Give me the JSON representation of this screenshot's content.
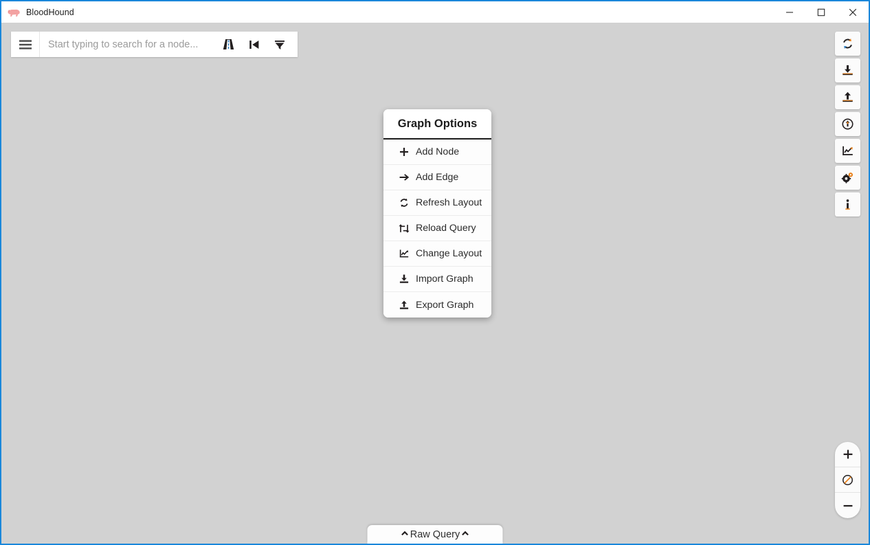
{
  "window": {
    "title": "BloodHound",
    "app_icon": "bloodhound-logo-icon",
    "controls": {
      "minimize": "minimize-icon",
      "maximize": "maximize-icon",
      "close": "close-icon"
    },
    "border_color": "#1a87da"
  },
  "search": {
    "placeholder": "Start typing to search for a node...",
    "value": "",
    "menu_icon": "hamburger-menu-icon",
    "actions": [
      {
        "icon": "pathfinding-road-icon",
        "name": "pathfinding-button"
      },
      {
        "icon": "tier-zero-skip-back-icon",
        "name": "tier-zero-button"
      },
      {
        "icon": "filter-funnel-icon",
        "name": "filter-button"
      }
    ]
  },
  "toolbar": {
    "buttons": [
      {
        "icon": "refresh-icon",
        "name": "refresh-graph-button"
      },
      {
        "icon": "download-import-icon",
        "name": "import-graph-button"
      },
      {
        "icon": "upload-export-icon",
        "name": "export-graph-button"
      },
      {
        "icon": "add-node-circle-icon",
        "name": "add-node-button"
      },
      {
        "icon": "chart-layout-icon",
        "name": "change-layout-button"
      },
      {
        "icon": "gears-settings-icon",
        "name": "settings-button"
      },
      {
        "icon": "info-icon",
        "name": "info-button"
      }
    ]
  },
  "zoom_controls": {
    "buttons": [
      {
        "icon": "plus-icon",
        "name": "zoom-in-button",
        "label": "+"
      },
      {
        "icon": "no-entry-reset-icon",
        "name": "zoom-reset-button",
        "label": ""
      },
      {
        "icon": "minus-icon",
        "name": "zoom-out-button",
        "label": "−"
      }
    ]
  },
  "raw_query": {
    "label": "Raw Query",
    "left_icon": "chevron-up-icon",
    "right_icon": "chevron-up-icon"
  },
  "context_menu": {
    "title": "Graph Options",
    "items": [
      {
        "label": "Add Node",
        "icon": "plus-icon",
        "name": "menu-item-add-node"
      },
      {
        "label": "Add Edge",
        "icon": "arrow-right-icon",
        "name": "menu-item-add-edge"
      },
      {
        "label": "Refresh Layout",
        "icon": "refresh-icon",
        "name": "menu-item-refresh-layout"
      },
      {
        "label": "Reload Query",
        "icon": "retweet-reload-icon",
        "name": "menu-item-reload-query"
      },
      {
        "label": "Change Layout",
        "icon": "chart-layout-icon",
        "name": "menu-item-change-layout"
      },
      {
        "label": "Import Graph",
        "icon": "download-import-icon",
        "name": "menu-item-import-graph"
      },
      {
        "label": "Export Graph",
        "icon": "upload-export-icon",
        "name": "menu-item-export-graph"
      }
    ]
  },
  "colors": {
    "canvas": "#d2d2d2",
    "panel": "#ffffff",
    "accent_orange": "#e8801a",
    "icon_dark": "#231f20",
    "window_border": "#1a87da"
  }
}
